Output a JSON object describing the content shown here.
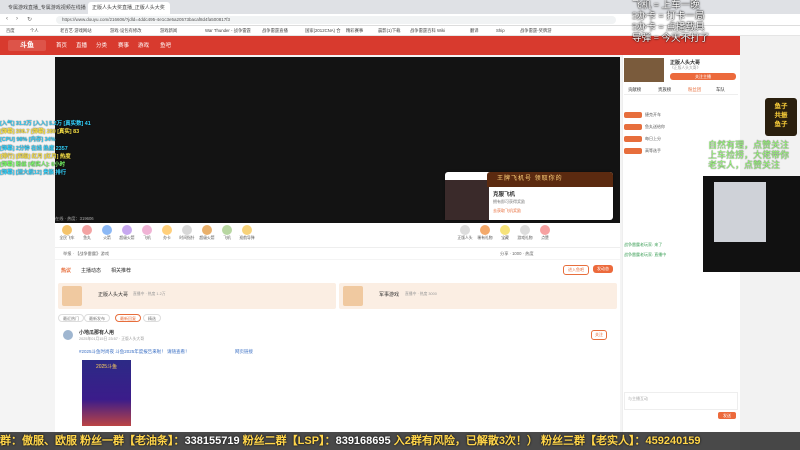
{
  "browser": {
    "tabs": [
      {
        "label": "专属游戏直播_专属游戏视频在线播放"
      },
      {
        "label": "正版人头大奖直播_正版人头大奖"
      }
    ],
    "url": "https://www.douyu.com/216606/?jdld=4ddc495-4e1c3e5a20573bacaf8d4fa500817f3",
    "bookmarks": [
      "百度",
      "个人",
      "老百艺·游戏网站",
      "游戏·设包有修改",
      "游戏新闻",
      "War Thunder - 战争雷霆",
      "战争雷霆直播",
      "国家(2012CNA) 合",
      "精彩赛事",
      "晨影(1)下载",
      "战争雷霆百科 Wiki",
      "翻译",
      "Ship",
      "战争雷霆-奖牌游"
    ]
  },
  "site_nav": {
    "logo": "斗鱼",
    "items": [
      "首页",
      "直播",
      "分类",
      "赛事",
      "游戏",
      "鱼吧"
    ],
    "search_placeholder": "搜索主播或直播间"
  },
  "player": {
    "viewer_text": "在线 · 热度：319606",
    "popup": {
      "title": "王牌飞机号 领取你的",
      "name": "克服飞机",
      "desc": "拥有即可获得奖励",
      "link": "去获取飞机奖励"
    }
  },
  "gifts": [
    "全民飞车",
    "鱼丸",
    "火箭",
    "超级火箭",
    "飞机",
    "办卡",
    "时间指针",
    "超级火箭",
    "飞机",
    "巡航导弹",
    "正版人头",
    "稀有礼物",
    "宝藏",
    "游戏礼物",
    "点赞"
  ],
  "room_bar": {
    "left": "举报 · 【战争雷霆】· 游戏",
    "right": "分享 · 1000 · 热度"
  },
  "room_tabs": [
    "热议",
    "主播动态",
    "相关推荐"
  ],
  "room_tab_actions": [
    "进入鱼吧",
    "发动态"
  ],
  "cards": [
    {
      "title": "正版人头大哥",
      "meta": "直播中 · 热度 1.2万"
    },
    {
      "title": "军事游戏",
      "meta": "直播中 · 热度 3000"
    }
  ],
  "sub_tabs": [
    "最近热门",
    "最新发布",
    "视频",
    "最新回复",
    "精选",
    "推荐"
  ],
  "post": {
    "author": "小地瓜那有人用",
    "time": "2025年01月15日 23:57 · 正版人头大哥",
    "text": "#2025斗鱼时尚夜 斗鱼2025年度报告来啦！ 请随查看！",
    "link": "网页链接",
    "poster_badge": "2025斗鱼"
  },
  "overlay_left": [
    "[入气] 31.2万 [入入] 5.2万 [真实数] 41",
    "[弹幕] 206.7 [弹幕] 280 [真实] 83",
    "[CPU] 98% [内存] 34%",
    "[弹幕] 2分钟 在线 热度 2357",
    "[排行] [四级] 红月 [红月] 热度",
    "[弹幕] 粉丝 [老实人]: 6小时",
    "[弹幕] [送大航12] 贵族 排行"
  ],
  "overlay_top": [
    "飞机 = 上车一晚",
    "5办卡 = 打卡一局",
    "5办卡 = 点播载具",
    "导弹 = 今天不打了"
  ],
  "green_overlay": [
    "自然有理，点赞关注",
    "上车捡捞，大佬带你",
    "老实人，点赞关注"
  ],
  "yellow_badge": [
    "鱼子",
    "共振",
    "鱼子"
  ],
  "sidebar": {
    "anchor_name": "正版人头大哥",
    "anchor_sub": "《正版人头大哥》",
    "follow_label": "关注主播",
    "tabs": [
      "贡献榜",
      "贵族榜",
      "粉丝团",
      "车队"
    ],
    "rows": [
      {
        "tag": "排行1",
        "text": "捷克开车"
      },
      {
        "tag": "排行2",
        "text": "鱼丸送给你"
      },
      {
        "tag": "排行3",
        "text": "每日上分"
      },
      {
        "tag": "排行4",
        "text": "高等选手"
      }
    ],
    "chat_placeholder": "与主播互动",
    "send_label": "发送",
    "chat_messages": [
      "战争雷霆老玩家: 来了",
      "战争雷霆老玩家: 直播中"
    ]
  },
  "ticker": {
    "prefix": "群：傲服、欧服  粉丝一群【老油条】：",
    "n1": "338155719",
    "mid": "  粉丝二群【LSP】：",
    "n2": "839168695",
    "suffix": " 入2群有风险，已解散3次！） 粉丝三群【老实人】：459240159"
  }
}
